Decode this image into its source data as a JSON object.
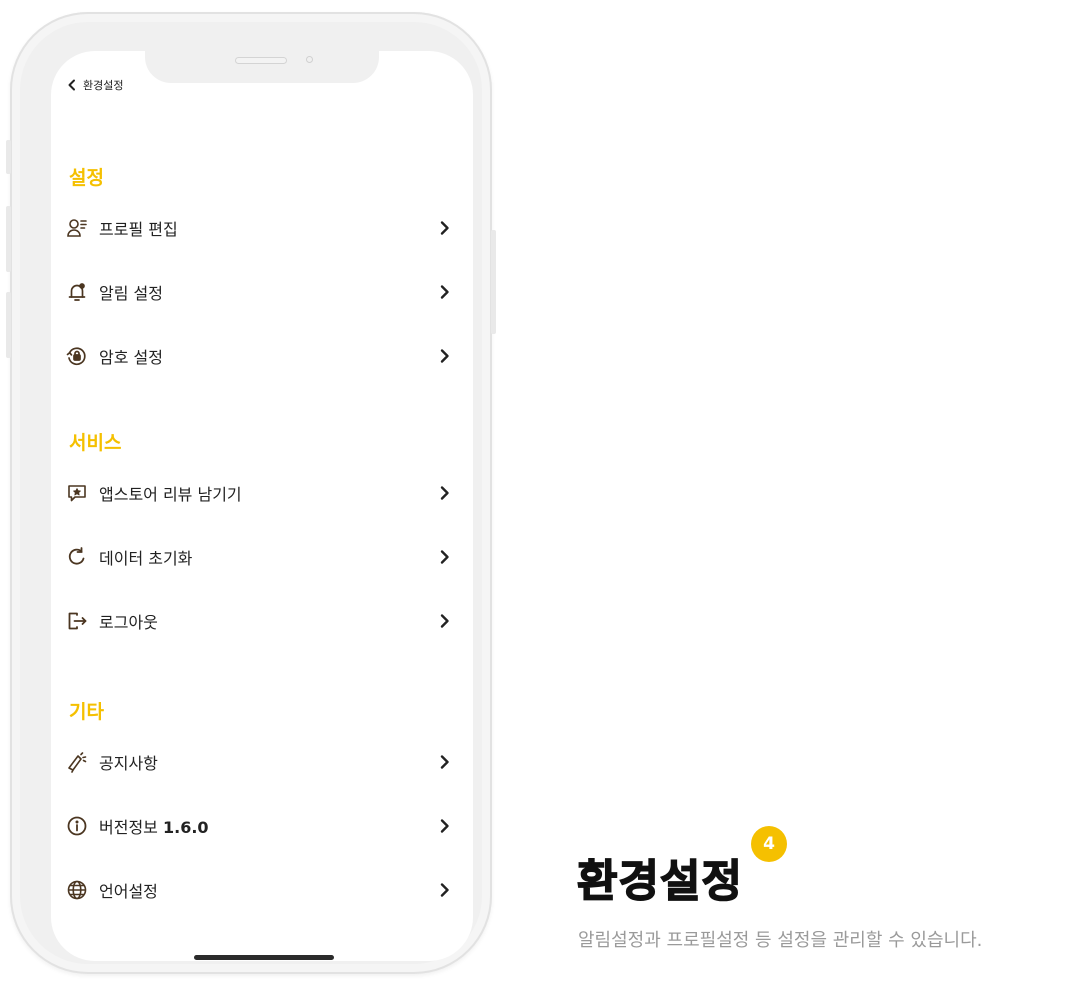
{
  "colors": {
    "accent": "#f5c000",
    "text": "#222222",
    "muted": "#9a9a9a",
    "icon": "#4b3621"
  },
  "screen": {
    "topbar": {
      "back_label": "환경설정"
    },
    "sections": [
      {
        "title": "설정",
        "items": [
          {
            "label": "프로필 편집",
            "icon": "profile-edit-icon"
          },
          {
            "label": "알림 설정",
            "icon": "bell-icon"
          },
          {
            "label": "암호 설정",
            "icon": "lock-refresh-icon"
          }
        ]
      },
      {
        "title": "서비스",
        "items": [
          {
            "label": "앱스토어 리뷰 남기기",
            "icon": "review-star-icon"
          },
          {
            "label": "데이터 초기화",
            "icon": "refresh-icon"
          },
          {
            "label": "로그아웃",
            "icon": "logout-icon"
          }
        ]
      },
      {
        "title": "기타",
        "items": [
          {
            "label": "공지사항",
            "icon": "megaphone-icon"
          },
          {
            "label": "버전정보",
            "version": "1.6.0",
            "icon": "info-icon"
          },
          {
            "label": "언어설정",
            "icon": "globe-icon"
          }
        ]
      }
    ]
  },
  "feature": {
    "title": "환경설정",
    "badge": "4",
    "description": "알림설정과 프로필설정 등 설정을 관리할 수 있습니다."
  }
}
